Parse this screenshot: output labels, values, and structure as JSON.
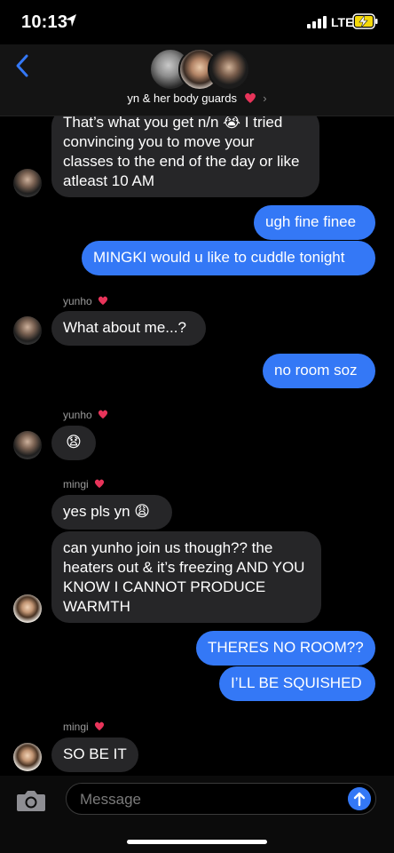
{
  "status_bar": {
    "time": "10:13",
    "network": "LTE"
  },
  "header": {
    "group_name": "yn & her body guards"
  },
  "messages": [
    {
      "text": "That’s what you get n/n 😭 I tried convincing you to move your classes to the end of the day or like atleast 10 AM"
    },
    {
      "text": "ugh fine finee"
    },
    {
      "text": "MINGKI would u like to cuddle tonight"
    },
    {
      "sender": "yunho",
      "text": "What about me...?"
    },
    {
      "text": "no room soz"
    },
    {
      "sender": "yunho",
      "text": "😧"
    },
    {
      "sender": "mingi",
      "text": "yes pls yn 😩"
    },
    {
      "text": "can yunho join us though?? the heaters out & it’s freezing AND YOU KNOW I CANNOT PRODUCE WARMTH"
    },
    {
      "text": "THERES NO ROOM??"
    },
    {
      "text": "I’LL BE SQUISHED"
    },
    {
      "sender": "mingi",
      "text": "SO BE IT"
    }
  ],
  "composer": {
    "placeholder": "Message"
  },
  "colors": {
    "outgoing": "#3478f6",
    "incoming": "#262628",
    "background": "#000000"
  },
  "icons": [
    "location-arrow-icon",
    "signal-bars-icon",
    "battery-charging-icon",
    "back-chevron-icon",
    "heart-icon",
    "camera-icon",
    "send-arrow-icon"
  ]
}
